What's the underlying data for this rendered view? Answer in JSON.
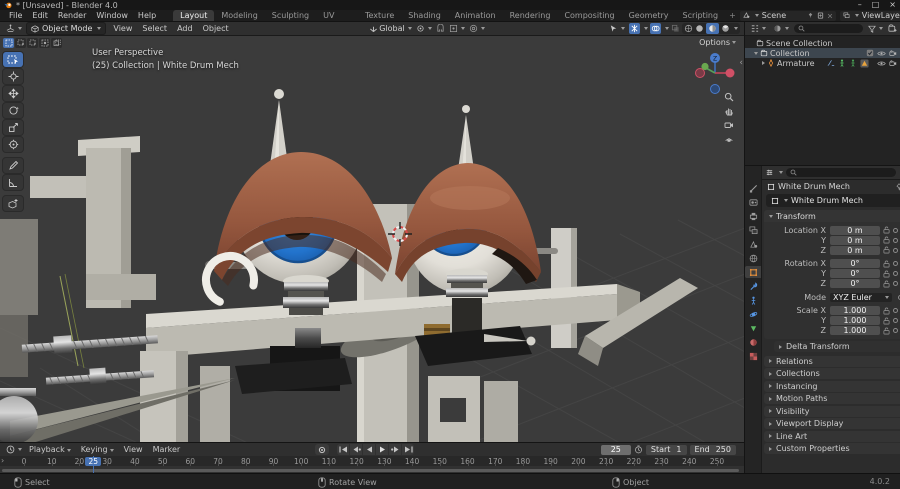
{
  "window": {
    "title": "* [Unsaved] - Blender 4.0",
    "controls": {
      "minimize": "–",
      "maximize": "□",
      "close": "×"
    }
  },
  "menubar": {
    "menus": [
      "File",
      "Edit",
      "Render",
      "Window",
      "Help"
    ],
    "tabs": [
      "Layout",
      "Modeling",
      "Sculpting",
      "UV Editing",
      "Texture Paint",
      "Shading",
      "Animation",
      "Rendering",
      "Compositing",
      "Geometry Nodes",
      "Scripting"
    ],
    "active_tab": "Layout",
    "add_tab": "+",
    "scene": {
      "label": "Scene"
    },
    "view_layer": {
      "label": "ViewLayer"
    }
  },
  "viewport_header": {
    "mode": "Object Mode",
    "menus": [
      "View",
      "Select",
      "Add",
      "Object"
    ],
    "orientation": "Global",
    "shading_modes": [
      "wireframe",
      "solid",
      "material-preview",
      "rendered"
    ],
    "active_shading": "material-preview"
  },
  "viewport": {
    "overlay_line1": "User Perspective",
    "overlay_line2": "(25) Collection | White Drum Mech",
    "options_label": "Options",
    "panel_toggle": "‹",
    "tools": [
      "select-box",
      "cursor",
      "move",
      "rotate",
      "scale",
      "transform",
      "annotate",
      "measure",
      "add-cube"
    ],
    "active_tool": "select-box"
  },
  "outliner": {
    "rows": [
      {
        "label": "Scene Collection",
        "icon": "scene-collection"
      },
      {
        "label": "Collection",
        "icon": "collection",
        "selected": true
      },
      {
        "label": "Armature",
        "icon": "armature"
      }
    ]
  },
  "properties": {
    "breadcrumb": "White Drum Mech",
    "id_name": "White Drum Mech",
    "tabs": [
      "tool",
      "render",
      "output",
      "view-layer",
      "scene",
      "world",
      "object",
      "modifiers",
      "constraints",
      "physics",
      "data",
      "material",
      "texture"
    ],
    "active_tab": "object",
    "transform": {
      "title": "Transform",
      "rows": [
        {
          "label": "Location X",
          "value": "0 m"
        },
        {
          "label": "Y",
          "value": "0 m"
        },
        {
          "label": "Z",
          "value": "0 m"
        },
        {
          "label": "Rotation X",
          "value": "0°"
        },
        {
          "label": "Y",
          "value": "0°"
        },
        {
          "label": "Z",
          "value": "0°"
        },
        {
          "label": "Mode",
          "value": "XYZ Euler",
          "dropdown": true
        },
        {
          "label": "Scale X",
          "value": "1.000"
        },
        {
          "label": "Y",
          "value": "1.000"
        },
        {
          "label": "Z",
          "value": "1.000"
        }
      ],
      "sub": "Delta Transform"
    },
    "panels": [
      "Relations",
      "Collections",
      "Instancing",
      "Motion Paths",
      "Visibility",
      "Viewport Display",
      "Line Art",
      "Custom Properties"
    ]
  },
  "timeline": {
    "menus": [
      "Playback",
      "Keying",
      "View",
      "Marker"
    ],
    "current_frame": "25",
    "frame_marker": "25",
    "start_label": "Start",
    "start": "1",
    "end_label": "End",
    "end": "250",
    "ticks": [
      0,
      10,
      20,
      30,
      40,
      50,
      60,
      70,
      80,
      90,
      100,
      110,
      120,
      130,
      140,
      150,
      160,
      170,
      180,
      190,
      200,
      210,
      220,
      230,
      240,
      250
    ],
    "overflow_arrow": "›"
  },
  "status": {
    "hints": [
      {
        "button": "left",
        "label": "Select"
      },
      {
        "button": "middle",
        "label": "Rotate View"
      },
      {
        "button": "right",
        "label": "Object"
      }
    ],
    "version": "4.0.2"
  },
  "colors": {
    "accent": "#4772b3",
    "iris": "#2e7fd2",
    "cap": "#9c5f46",
    "frame": "#c9c7bf"
  }
}
